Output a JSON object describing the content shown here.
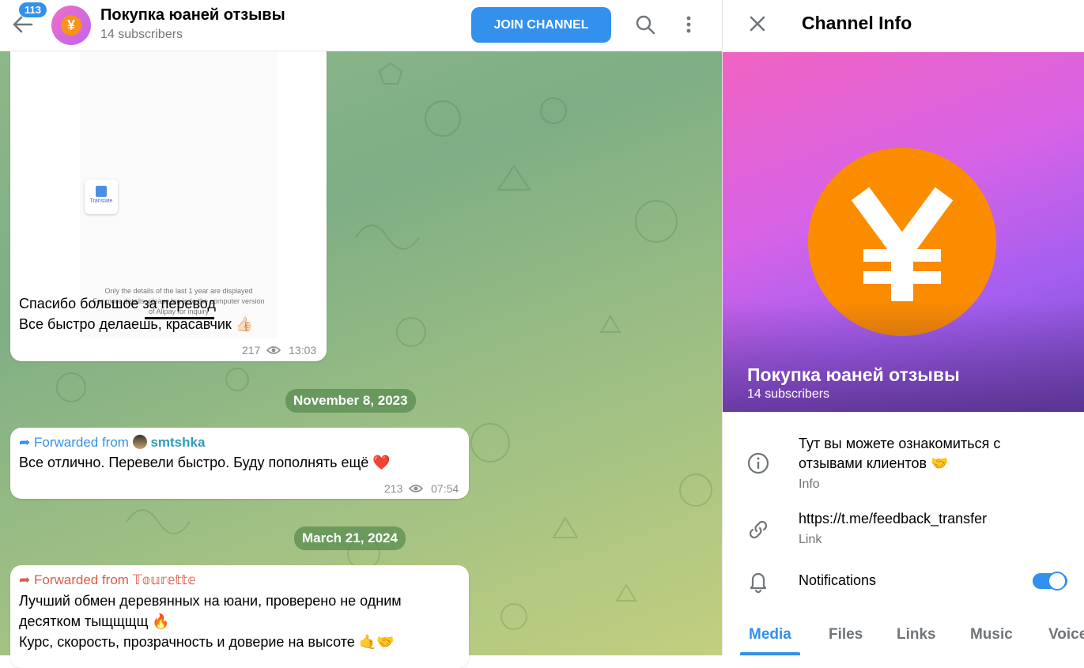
{
  "header": {
    "unread_badge": "113",
    "channel_title": "Покупка юаней отзывы",
    "subscribers": "14 subscribers",
    "join_label": "JOIN CHANNEL",
    "avatar_symbol": "¥"
  },
  "messages": [
    {
      "screenshot_lines": [
        "Only the details of the last 1 year are displayed",
        "For more details, please log in to the computer version",
        "of Alipay for inquiry"
      ],
      "translate_label": "Translate",
      "line1": "Спасибо большое за перевод",
      "line2": "Все быстро делаешь, красавчик 👍🏻",
      "views": "217",
      "time": "13:03"
    },
    {
      "forwarded_prefix": "Forwarded from",
      "forwarded_name": "smtshka",
      "text": "Все отлично. Перевели быстро. Буду пополнять ещё ❤️",
      "views": "213",
      "time": "07:54"
    },
    {
      "forwarded_prefix": "Forwarded from",
      "forwarded_name": "𝕋𝕠𝕦𝕣𝕖𝕥𝕥𝕖",
      "line1": "Лучший обмен деревянных на юани, проверено не одним",
      "line2": "десятком тыщщщщ 🔥",
      "line3": "Курс, скорость, прозрачность и доверие на высоте 🤙🤝"
    }
  ],
  "dates": [
    "November 8, 2023",
    "March 21, 2024"
  ],
  "panel": {
    "title": "Channel Info",
    "name": "Покупка юаней отзывы",
    "subscribers": "14 subscribers",
    "info_line1": "Тут вы можете ознакомиться с",
    "info_line2": "отзывами клиентов 🤝",
    "info_label": "Info",
    "link": "https://t.me/feedback_transfer",
    "link_label": "Link",
    "notifications_label": "Notifications",
    "notifications_on": true,
    "tabs": [
      "Media",
      "Files",
      "Links",
      "Music",
      "Voice"
    ],
    "active_tab": "Media"
  },
  "colors": {
    "accent": "#3390ec",
    "coin": "#fb8c00"
  }
}
